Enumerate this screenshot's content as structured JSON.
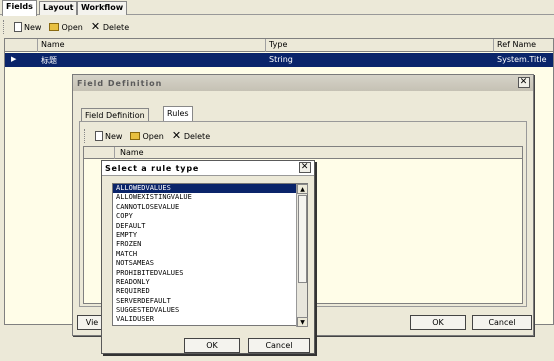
{
  "top_tabs": [
    "Fields",
    "Layout",
    "Workflow"
  ],
  "toolbar": {
    "new": "New",
    "open": "Open",
    "delete": "Delete"
  },
  "grid": {
    "columns": [
      "Name",
      "Type",
      "Ref Name"
    ],
    "rows": [
      {
        "name": "标题",
        "type": "String",
        "ref": "System.Title"
      }
    ]
  },
  "field_dialog": {
    "title": "Field Definition",
    "tabs": [
      "Field Definition",
      "Rules"
    ],
    "toolbar": {
      "new": "New",
      "open": "Open",
      "delete": "Delete"
    },
    "column": "Name",
    "view_button": "Vie",
    "ok": "OK",
    "cancel": "Cancel"
  },
  "rule_dialog": {
    "title": "Select a rule type",
    "items": [
      "ALLOWEDVALUES",
      "ALLOWEXISTINGVALUE",
      "CANNOTLOSEVALUE",
      "COPY",
      "DEFAULT",
      "EMPTY",
      "FROZEN",
      "MATCH",
      "NOTSAMEAS",
      "PROHIBITEDVALUES",
      "READONLY",
      "REQUIRED",
      "SERVERDEFAULT",
      "SUGGESTEDVALUES",
      "VALIDUSER"
    ],
    "selected": "ALLOWEDVALUES",
    "ok": "OK",
    "cancel": "Cancel"
  }
}
